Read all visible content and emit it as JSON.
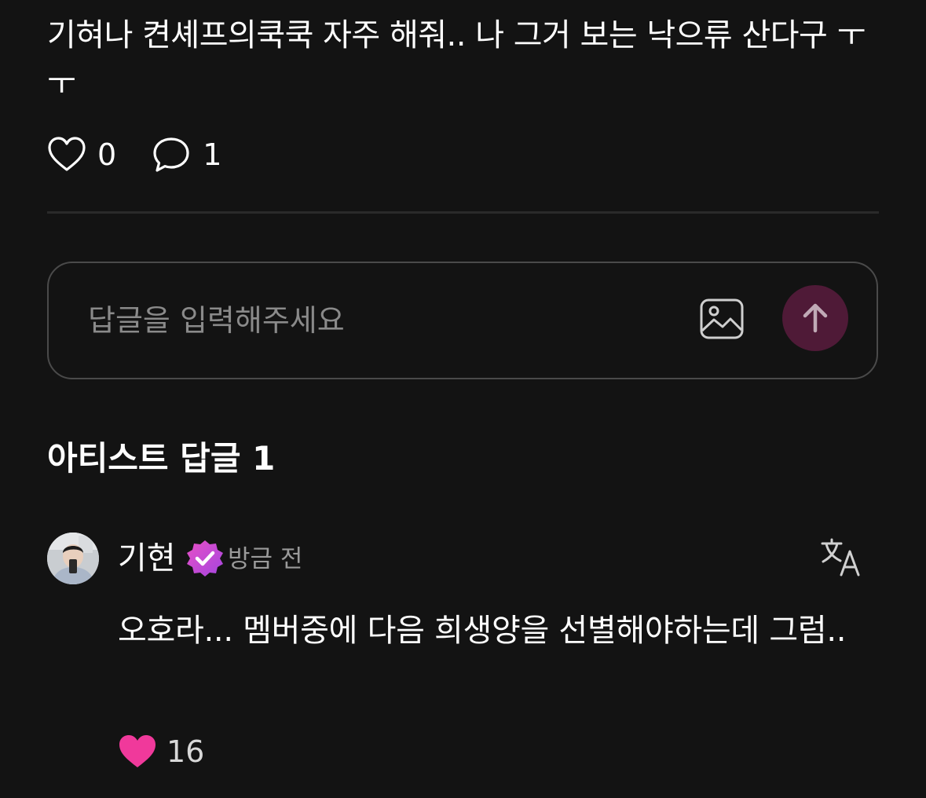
{
  "post": {
    "text": "기혀나 켠셰프의쿡쿡 자주 해줘.. 나 그거 보는 낙으류 산다구 ㅜㅜ",
    "like_count": "0",
    "comment_count": "1"
  },
  "reply_box": {
    "placeholder": "답글을 입력해주세요"
  },
  "artist_replies": {
    "title": "아티스트 답글 1"
  },
  "comment": {
    "author": "기현",
    "time": "방금 전",
    "text": "오호라... 멤버중에 다음 희생양을 선별해야하는데 그럼..",
    "like_count": "16"
  },
  "colors": {
    "background": "#131313",
    "send_button": "#4f1a37",
    "liked_heart": "#f0399b",
    "verified_badge": "#c44cd9"
  },
  "icons": {
    "like": "heart-outline-icon",
    "comment": "speech-bubble-icon",
    "attach": "image-icon",
    "send": "arrow-up-icon",
    "verified": "verified-badge-icon",
    "translate": "translate-icon",
    "liked": "heart-filled-icon"
  }
}
